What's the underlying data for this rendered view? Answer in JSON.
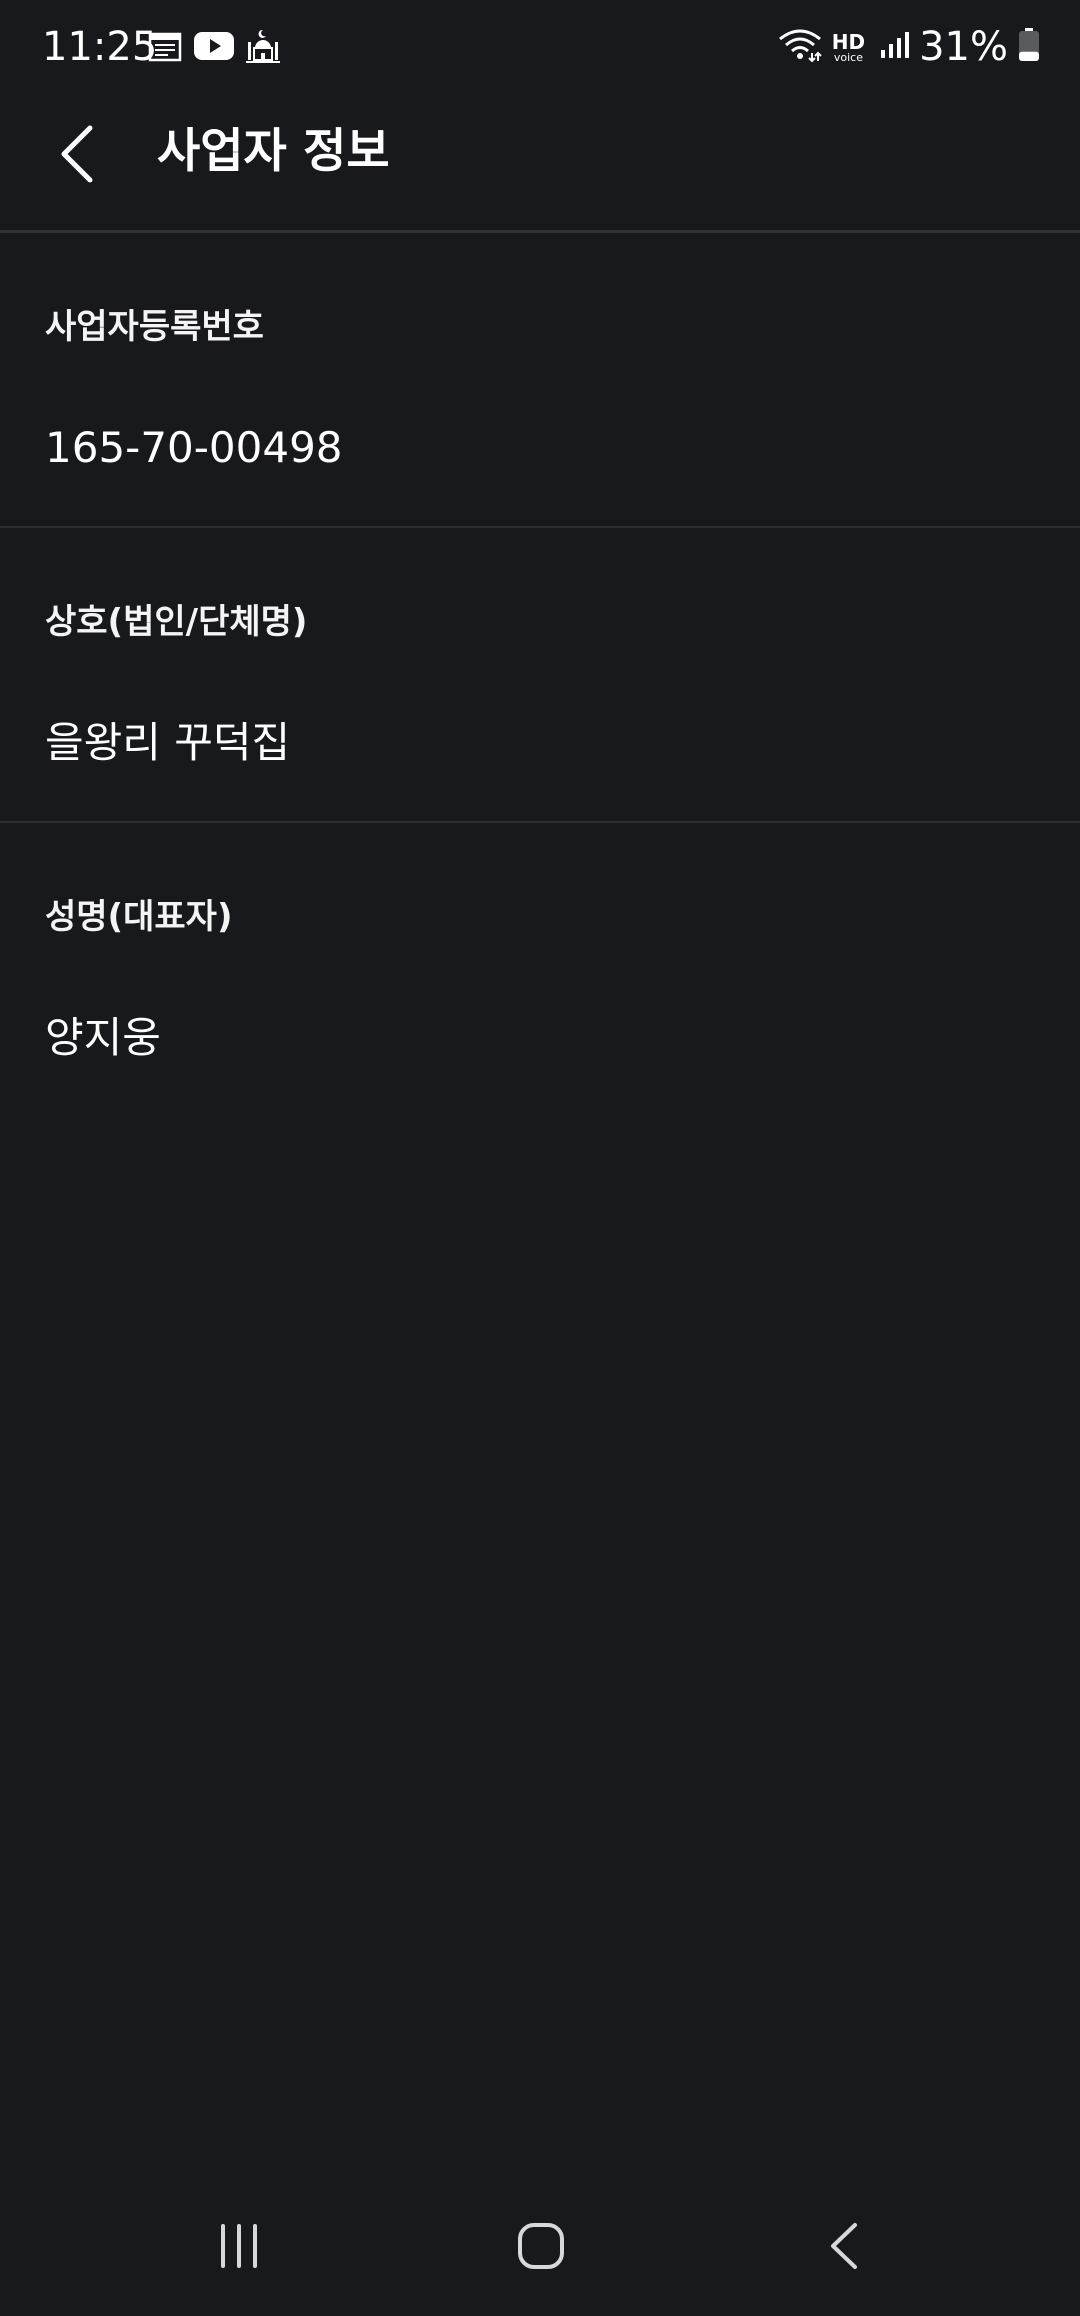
{
  "status_bar": {
    "time": "11:25",
    "left_icons": [
      "calendar-icon",
      "youtube-icon",
      "mosque-icon"
    ],
    "right_icons": [
      "wifi-icon",
      "hd-voice-icon",
      "signal-icon",
      "battery-icon"
    ],
    "hd_label": "HD",
    "voice_label": "voice",
    "battery_percent": "31%",
    "battery_level": 0.31
  },
  "header": {
    "back_icon": "chevron-left-icon",
    "title": "사업자 정보"
  },
  "sections": [
    {
      "label": "사업자등록번호",
      "value": "165-70-00498"
    },
    {
      "label": "상호(법인/단체명)",
      "value": "을왕리 꾸덕집"
    },
    {
      "label": "성명(대표자)",
      "value": "양지웅"
    }
  ],
  "nav_bar": {
    "recents_icon": "recents-icon",
    "home_icon": "home-icon",
    "back_icon": "back-icon"
  },
  "colors": {
    "background": "#18191d",
    "divider": "#2b2d32",
    "text": "#ffffff"
  }
}
